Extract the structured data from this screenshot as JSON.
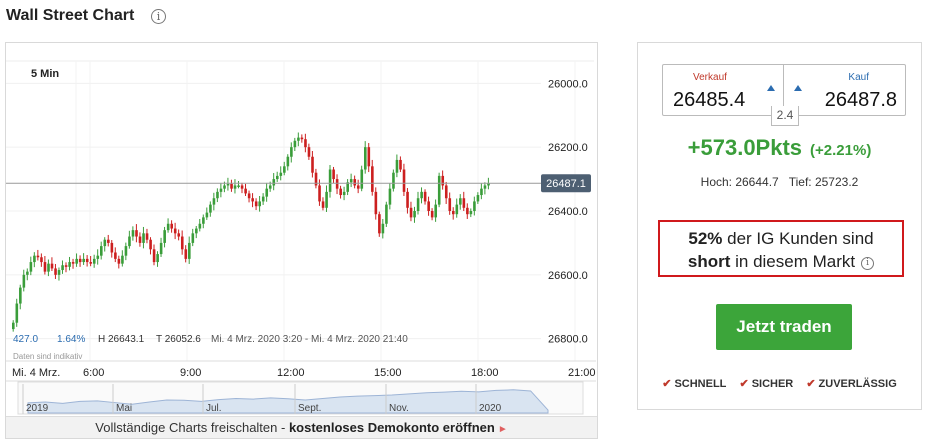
{
  "title": "Wall Street Chart",
  "chart": {
    "interval": "5 Min",
    "y_ticks": [
      "26800.0",
      "26600.0",
      "26400.0",
      "26200.0",
      "26000.0"
    ],
    "y_tick_values": [
      26800,
      26600,
      26400,
      26200,
      26000
    ],
    "current_price_label": "26487.1",
    "current_price": 26487.1,
    "stats": {
      "value": "427.0",
      "pct": "1.64%",
      "high": "H 26643.1",
      "low": "T 26052.6",
      "range": "Mi. 4 Mrz. 2020 3:20 - Mi. 4 Mrz. 2020 21:40"
    },
    "indicative_note": "Daten sind indikativ",
    "x_ticks": [
      "Mi. 4 Mrz.",
      "6:00",
      "9:00",
      "12:00",
      "15:00",
      "18:00",
      "21:00"
    ],
    "overview_labels": [
      "2019",
      "Mai",
      "Jul.",
      "Sept.",
      "Nov.",
      "2020"
    ]
  },
  "chart_data": {
    "type": "candlestick",
    "interval": "5 Min",
    "ylim": [
      25930,
      26870
    ],
    "x_ticks": [
      "Mi. 4 Mrz.",
      "6:00",
      "9:00",
      "12:00",
      "15:00",
      "18:00",
      "21:00"
    ],
    "y_ticks": [
      26000,
      26200,
      26400,
      26600,
      26800
    ],
    "last": 26487.1,
    "close_series": [
      26050,
      26110,
      26160,
      26200,
      26210,
      26240,
      26260,
      26255,
      26240,
      26210,
      26235,
      26220,
      26200,
      26215,
      26230,
      26225,
      26240,
      26235,
      26250,
      26240,
      26250,
      26240,
      26235,
      26250,
      26260,
      26290,
      26310,
      26300,
      26270,
      26250,
      26235,
      26260,
      26290,
      26320,
      26340,
      26320,
      26300,
      26330,
      26310,
      26280,
      26240,
      26265,
      26300,
      26340,
      26360,
      26345,
      26330,
      26320,
      26280,
      26250,
      26300,
      26330,
      26345,
      26360,
      26380,
      26395,
      26420,
      26440,
      26460,
      26470,
      26480,
      26485,
      26470,
      26480,
      26480,
      26470,
      26455,
      26440,
      26430,
      26415,
      26430,
      26445,
      26470,
      26480,
      26500,
      26510,
      26520,
      26540,
      26570,
      26600,
      26620,
      26630,
      26625,
      26600,
      26570,
      26520,
      26480,
      26430,
      26410,
      26460,
      26530,
      26500,
      26470,
      26450,
      26460,
      26490,
      26500,
      26480,
      26470,
      26530,
      26600,
      26540,
      26460,
      26390,
      26330,
      26360,
      26420,
      26470,
      26520,
      26560,
      26530,
      26460,
      26410,
      26380,
      26400,
      26440,
      26460,
      26430,
      26400,
      26380,
      26420,
      26510,
      26480,
      26440,
      26400,
      26390,
      26420,
      26440,
      26410,
      26390,
      26400,
      26430,
      26450,
      26470,
      26480,
      26487
    ]
  },
  "prices": {
    "sell_label": "Verkauf",
    "sell": "26485.4",
    "buy_label": "Kauf",
    "buy": "26487.8",
    "spread": "2.4"
  },
  "change": {
    "points": "+573.0Pkts",
    "percent": "(+2.21%)"
  },
  "hilo": {
    "high": "Hoch: 26644.7",
    "low": "Tief: 25723.2"
  },
  "sentiment": {
    "pct": "52%",
    "text1": " der IG Kunden sind",
    "word": "short",
    "text2": " in diesem Markt"
  },
  "cta": "Jetzt traden",
  "features": [
    "SCHNELL",
    "SICHER",
    "ZUVERLÄSSIG"
  ],
  "footer": {
    "text": "Vollständige Charts freischalten - ",
    "link": "kostenloses Demokonto eröffnen"
  },
  "colors": {
    "up": "#3a9d3a",
    "down": "#cc1f1f",
    "button": "#3ca53a",
    "alert_border": "#d0191c"
  }
}
